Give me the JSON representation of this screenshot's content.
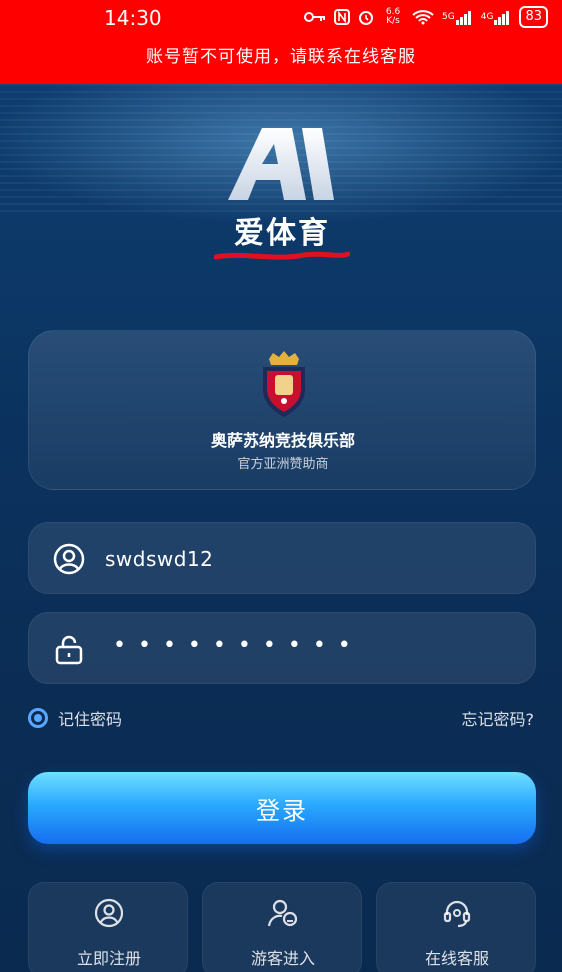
{
  "status_bar": {
    "time": "14:30",
    "net_speed": "6.6 K/s",
    "signal_1": "5G",
    "signal_2": "4G",
    "battery": "83"
  },
  "banner": {
    "text": "账号暂不可使用，请联系在线客服",
    "color": "#ff0000"
  },
  "brand": {
    "logo_letters": "AI",
    "app_name": "爱体育"
  },
  "sponsor": {
    "club_name": "奥萨苏纳竞技俱乐部",
    "subtitle": "官方亚洲赞助商",
    "crest_icon": "osasuna-crest-icon"
  },
  "login_form": {
    "username_value": "swdswd12",
    "password_masked": "••••••••••",
    "username_icon": "user-circle-icon",
    "password_icon": "lock-icon",
    "remember_label": "记住密码",
    "remember_checked": true,
    "forgot_label": "忘记密码?",
    "submit_label": "登录"
  },
  "bottom_actions": [
    {
      "label": "立即注册",
      "icon": "user-circle-icon"
    },
    {
      "label": "游客进入",
      "icon": "guest-user-icon"
    },
    {
      "label": "在线客服",
      "icon": "headset-icon"
    }
  ],
  "colors": {
    "accent": "#2aa9ff",
    "background": "#0b2e57"
  }
}
